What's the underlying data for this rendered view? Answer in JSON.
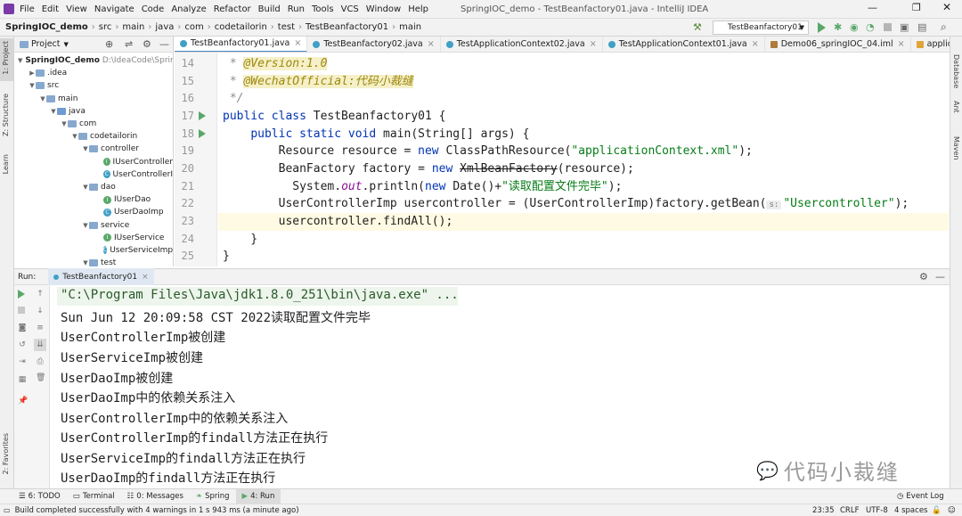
{
  "window": {
    "title": "SpringIOC_demo - TestBeanfactory01.java - IntelliJ IDEA"
  },
  "menu": [
    "File",
    "Edit",
    "View",
    "Navigate",
    "Code",
    "Analyze",
    "Refactor",
    "Build",
    "Run",
    "Tools",
    "VCS",
    "Window",
    "Help"
  ],
  "breadcrumb": [
    "SpringIOC_demo",
    "src",
    "main",
    "java",
    "com",
    "codetailorin",
    "test",
    "TestBeanfactory01",
    "main"
  ],
  "run_config": "TestBeanfactory01",
  "project": {
    "header": "Project",
    "root_name": "SpringIOC_demo",
    "root_path": "D:\\IdeaCode\\Sprin",
    "items": [
      ".idea",
      "src",
      "main",
      "java",
      "com",
      "codetailorin",
      "controller",
      "IUserController",
      "UserControllerI",
      "dao",
      "IUserDao",
      "UserDaoImp",
      "service",
      "IUserService",
      "UserServiceImp",
      "test"
    ]
  },
  "tool_strip": {
    "project": "1: Project",
    "structure": "Z: Structure",
    "learn": "Learn",
    "favorites": "2: Favorites",
    "database": "Database",
    "ant": "Ant",
    "maven": "Maven"
  },
  "tabs": [
    "TestBeanfactory01.java",
    "TestBeanfactory02.java",
    "TestApplicationContext02.java",
    "TestApplicationContext01.java",
    "Demo06_springIOC_04.iml",
    "applicationContext.xml"
  ],
  "code": {
    "line_numbers": [
      "14",
      "15",
      "16",
      "17",
      "18",
      "19",
      "20",
      "21",
      "22",
      "23",
      "24",
      "25"
    ],
    "l14_prefix": " * ",
    "l14_ann": "@Version:1.0",
    "l15_prefix": " * ",
    "l15_ann": "@WechatOfficial:代码小裁缝",
    "l16": " */",
    "l17_kw": "public class ",
    "l17_rest": "TestBeanfactory01 {",
    "l18_indent": "    ",
    "l18_kw": "public static void ",
    "l18_rest": "main(String[] args) {",
    "l19_a": "        Resource resource = ",
    "l19_kw": "new ",
    "l19_b": "ClassPathResource(",
    "l19_str": "\"applicationContext.xml\"",
    "l19_c": ");",
    "l20_a": "        BeanFactory factory = ",
    "l20_kw": "new ",
    "l20_strike": "XmlBeanFactory",
    "l20_c": "(resource);",
    "l21_a": "          System.",
    "l21_out": "out",
    "l21_b": ".println(",
    "l21_kw": "new ",
    "l21_c": "Date()+",
    "l21_str": "\"读取配置文件完毕\"",
    "l21_d": ");",
    "l22_a": "        UserControllerImp usercontroller = (UserControllerImp)factory.getBean(",
    "l22_hint": "s:",
    "l22_str": "\"Usercontroller\"",
    "l22_c": ");",
    "l23": "        usercontroller.findAll();",
    "l24": "    }",
    "l25": "}"
  },
  "run_panel": {
    "label": "Run:",
    "tab": "TestBeanfactory01"
  },
  "console": [
    "\"C:\\Program Files\\Java\\jdk1.8.0_251\\bin\\java.exe\" ...",
    "Sun Jun 12 20:09:58 CST 2022读取配置文件完毕",
    "UserControllerImp被创建",
    "UserServiceImp被创建",
    "UserDaoImp被创建",
    "UserDaoImp中的依赖关系注入",
    "UserControllerImp中的依赖关系注入",
    "UserControllerImp的findall方法正在执行",
    "UserServiceImp的findall方法正在执行",
    "UserDaoImp的findall方法正在执行"
  ],
  "watermark": "代码小裁缝",
  "bottom_tabs": [
    "6: TODO",
    "Terminal",
    "0: Messages",
    "Spring",
    "4: Run"
  ],
  "event_log": "Event Log",
  "status": {
    "message": "Build completed successfully with 4 warnings in 1 s 943 ms (a minute ago)",
    "position": "23:35",
    "line_sep": "CRLF",
    "encoding": "UTF-8",
    "indent": "4 spaces"
  }
}
